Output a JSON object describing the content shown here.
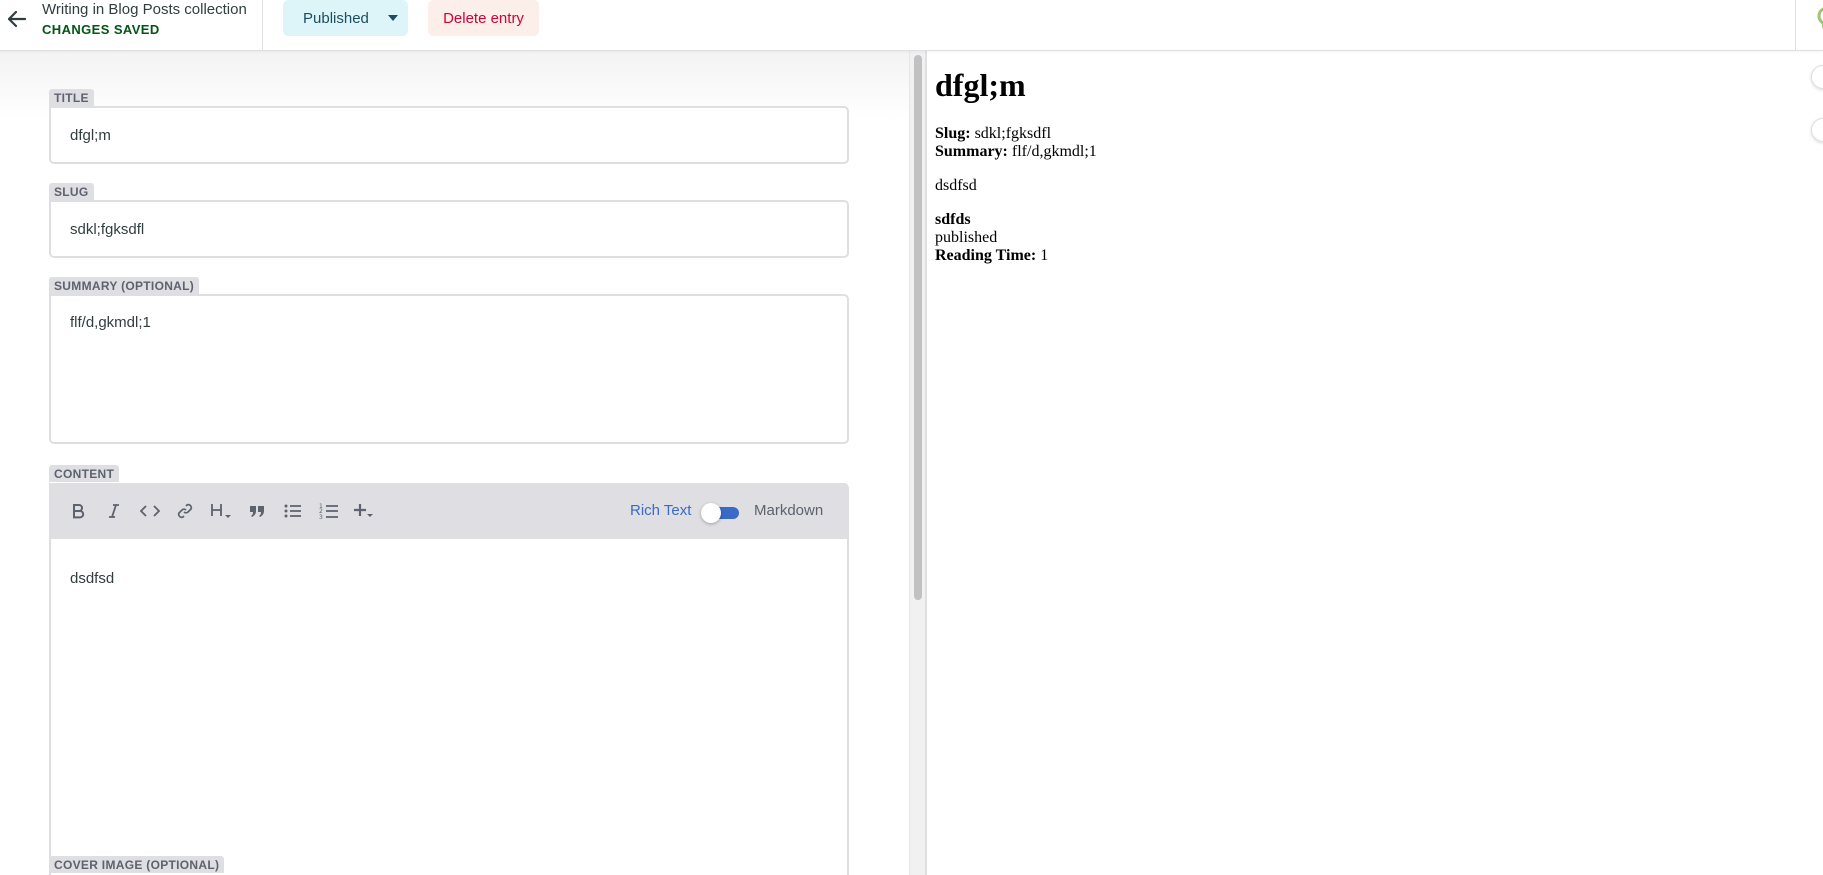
{
  "header": {
    "collection_title": "Writing in Blog Posts collection",
    "save_status": "CHANGES SAVED",
    "publish_label": "Published",
    "delete_label": "Delete entry"
  },
  "fields": {
    "title": {
      "label": "TITLE",
      "value": "dfgl;m"
    },
    "slug": {
      "label": "SLUG",
      "value": "sdkl;fgksdfl"
    },
    "summary": {
      "label": "SUMMARY (OPTIONAL)",
      "value": "flf/d,gkmdl;1"
    },
    "content": {
      "label": "CONTENT",
      "value": "dsdfsd"
    },
    "cover_image": {
      "label": "COVER IMAGE (OPTIONAL)"
    }
  },
  "toolbar": {
    "icons": [
      "bold-icon",
      "italic-icon",
      "code-icon",
      "link-icon",
      "heading-icon",
      "quote-icon",
      "bulleted-list-icon",
      "numbered-list-icon",
      "add-component-icon"
    ],
    "rich_text_label": "Rich Text",
    "markdown_label": "Markdown"
  },
  "preview": {
    "title": "dfgl;m",
    "slug_label": "Slug:",
    "slug_value": "sdkl;fgksdfl",
    "summary_label": "Summary:",
    "summary_value": "flf/d,gkmdl;1",
    "body": "dsdfsd",
    "bold_text": "sdfds",
    "status": "published",
    "reading_time_label": "Reading Time:",
    "reading_time_value": "1"
  },
  "colors": {
    "accent": "#3a69c7",
    "saved_green": "#005614",
    "publish_bg": "#ddf5f9",
    "delete_bg": "#fcefea",
    "delete_text": "#d60032",
    "label_bg": "#dfdfe3"
  }
}
